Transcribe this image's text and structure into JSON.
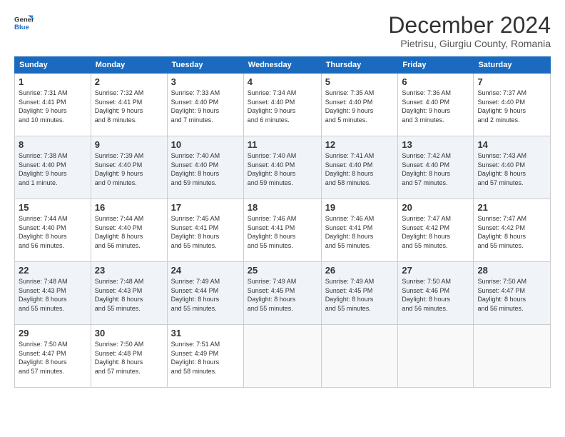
{
  "header": {
    "logo_line1": "General",
    "logo_line2": "Blue",
    "title": "December 2024",
    "subtitle": "Pietrisu, Giurgiu County, Romania"
  },
  "calendar": {
    "days_of_week": [
      "Sunday",
      "Monday",
      "Tuesday",
      "Wednesday",
      "Thursday",
      "Friday",
      "Saturday"
    ],
    "weeks": [
      [
        {
          "day": "",
          "info": ""
        },
        {
          "day": "2",
          "info": "Sunrise: 7:32 AM\nSunset: 4:41 PM\nDaylight: 9 hours\nand 8 minutes."
        },
        {
          "day": "3",
          "info": "Sunrise: 7:33 AM\nSunset: 4:40 PM\nDaylight: 9 hours\nand 7 minutes."
        },
        {
          "day": "4",
          "info": "Sunrise: 7:34 AM\nSunset: 4:40 PM\nDaylight: 9 hours\nand 6 minutes."
        },
        {
          "day": "5",
          "info": "Sunrise: 7:35 AM\nSunset: 4:40 PM\nDaylight: 9 hours\nand 5 minutes."
        },
        {
          "day": "6",
          "info": "Sunrise: 7:36 AM\nSunset: 4:40 PM\nDaylight: 9 hours\nand 3 minutes."
        },
        {
          "day": "7",
          "info": "Sunrise: 7:37 AM\nSunset: 4:40 PM\nDaylight: 9 hours\nand 2 minutes."
        }
      ],
      [
        {
          "day": "1",
          "info": "Sunrise: 7:31 AM\nSunset: 4:41 PM\nDaylight: 9 hours\nand 10 minutes.",
          "first_row": true
        },
        {
          "day": "8",
          "info": "Sunrise: 7:38 AM\nSunset: 4:40 PM\nDaylight: 9 hours\nand 1 minute."
        },
        {
          "day": "9",
          "info": "Sunrise: 7:39 AM\nSunset: 4:40 PM\nDaylight: 9 hours\nand 0 minutes."
        },
        {
          "day": "10",
          "info": "Sunrise: 7:40 AM\nSunset: 4:40 PM\nDaylight: 8 hours\nand 59 minutes."
        },
        {
          "day": "11",
          "info": "Sunrise: 7:40 AM\nSunset: 4:40 PM\nDaylight: 8 hours\nand 59 minutes."
        },
        {
          "day": "12",
          "info": "Sunrise: 7:41 AM\nSunset: 4:40 PM\nDaylight: 8 hours\nand 58 minutes."
        },
        {
          "day": "13",
          "info": "Sunrise: 7:42 AM\nSunset: 4:40 PM\nDaylight: 8 hours\nand 57 minutes."
        },
        {
          "day": "14",
          "info": "Sunrise: 7:43 AM\nSunset: 4:40 PM\nDaylight: 8 hours\nand 57 minutes."
        }
      ],
      [
        {
          "day": "15",
          "info": "Sunrise: 7:44 AM\nSunset: 4:40 PM\nDaylight: 8 hours\nand 56 minutes."
        },
        {
          "day": "16",
          "info": "Sunrise: 7:44 AM\nSunset: 4:40 PM\nDaylight: 8 hours\nand 56 minutes."
        },
        {
          "day": "17",
          "info": "Sunrise: 7:45 AM\nSunset: 4:41 PM\nDaylight: 8 hours\nand 55 minutes."
        },
        {
          "day": "18",
          "info": "Sunrise: 7:46 AM\nSunset: 4:41 PM\nDaylight: 8 hours\nand 55 minutes."
        },
        {
          "day": "19",
          "info": "Sunrise: 7:46 AM\nSunset: 4:41 PM\nDaylight: 8 hours\nand 55 minutes."
        },
        {
          "day": "20",
          "info": "Sunrise: 7:47 AM\nSunset: 4:42 PM\nDaylight: 8 hours\nand 55 minutes."
        },
        {
          "day": "21",
          "info": "Sunrise: 7:47 AM\nSunset: 4:42 PM\nDaylight: 8 hours\nand 55 minutes."
        }
      ],
      [
        {
          "day": "22",
          "info": "Sunrise: 7:48 AM\nSunset: 4:43 PM\nDaylight: 8 hours\nand 55 minutes."
        },
        {
          "day": "23",
          "info": "Sunrise: 7:48 AM\nSunset: 4:43 PM\nDaylight: 8 hours\nand 55 minutes."
        },
        {
          "day": "24",
          "info": "Sunrise: 7:49 AM\nSunset: 4:44 PM\nDaylight: 8 hours\nand 55 minutes."
        },
        {
          "day": "25",
          "info": "Sunrise: 7:49 AM\nSunset: 4:45 PM\nDaylight: 8 hours\nand 55 minutes."
        },
        {
          "day": "26",
          "info": "Sunrise: 7:49 AM\nSunset: 4:45 PM\nDaylight: 8 hours\nand 55 minutes."
        },
        {
          "day": "27",
          "info": "Sunrise: 7:50 AM\nSunset: 4:46 PM\nDaylight: 8 hours\nand 56 minutes."
        },
        {
          "day": "28",
          "info": "Sunrise: 7:50 AM\nSunset: 4:47 PM\nDaylight: 8 hours\nand 56 minutes."
        }
      ],
      [
        {
          "day": "29",
          "info": "Sunrise: 7:50 AM\nSunset: 4:47 PM\nDaylight: 8 hours\nand 57 minutes."
        },
        {
          "day": "30",
          "info": "Sunrise: 7:50 AM\nSunset: 4:48 PM\nDaylight: 8 hours\nand 57 minutes."
        },
        {
          "day": "31",
          "info": "Sunrise: 7:51 AM\nSunset: 4:49 PM\nDaylight: 8 hours\nand 58 minutes."
        },
        {
          "day": "",
          "info": ""
        },
        {
          "day": "",
          "info": ""
        },
        {
          "day": "",
          "info": ""
        },
        {
          "day": "",
          "info": ""
        }
      ]
    ]
  }
}
